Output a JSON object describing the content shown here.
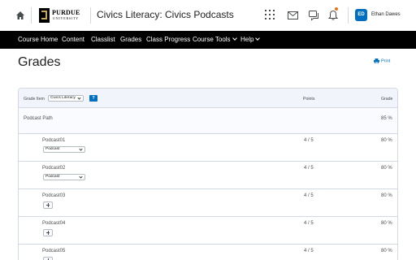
{
  "header": {
    "logo_line1": "PURDUE",
    "logo_line2": "UNIVERSITY",
    "course_title": "Civics Literacy: Civics Podcasts",
    "user_initials": "ED",
    "user_name": "Ethan Dawes",
    "icons": [
      "home-icon",
      "apps-grid-icon",
      "mail-icon",
      "chat-icon",
      "bell-icon"
    ],
    "notification_color": "#e87511"
  },
  "nav": {
    "items": [
      {
        "label": "Course Home"
      },
      {
        "label": "Content"
      },
      {
        "label": "Classlist"
      },
      {
        "label": "Grades"
      },
      {
        "label": "Class Progress"
      },
      {
        "label": "Course Tools"
      },
      {
        "label": "Help"
      }
    ]
  },
  "page": {
    "title": "Grades",
    "print_label": "Print"
  },
  "grades": {
    "grade_item_label": "Grade Item",
    "grade_item_value": "Civics Literacy",
    "help_label": "?",
    "col_points": "Points",
    "col_grade": "Grade",
    "path": {
      "name": "Podcast Path",
      "grade": "85 %"
    },
    "rows": [
      {
        "name": "Podcast01",
        "points": "4 / 5",
        "grade": "80 %",
        "select_value": "Podcast"
      },
      {
        "name": "Podcast02",
        "points": "4 / 5",
        "grade": "80 %",
        "select_value": "Podcast"
      },
      {
        "name": "Podcast03",
        "points": "4 / 5",
        "grade": "80 %"
      },
      {
        "name": "Podcast04",
        "points": "4 / 5",
        "grade": "80 %"
      },
      {
        "name": "Podcast05",
        "points": "4 / 5",
        "grade": "80 %"
      }
    ]
  },
  "colors": {
    "nav_bg": "#000000",
    "accent": "#006fbf",
    "border": "#d3d9e3"
  }
}
